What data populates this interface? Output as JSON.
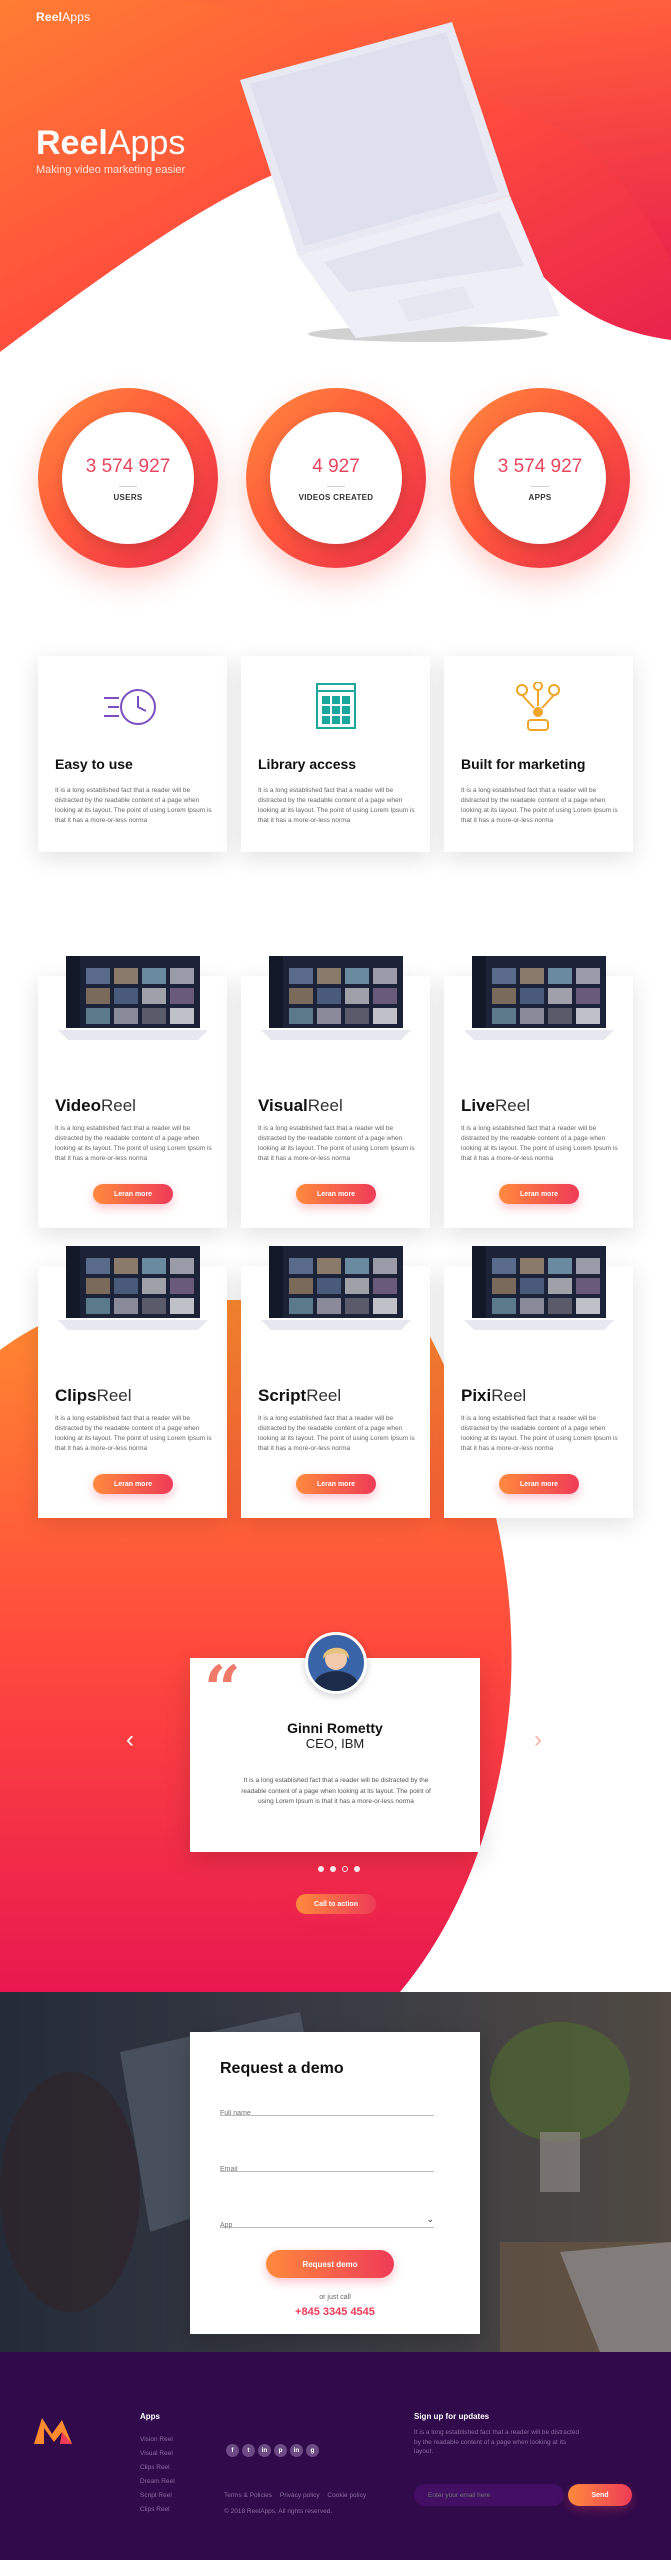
{
  "brand": {
    "bold": "Reel",
    "thin": "Apps"
  },
  "hero": {
    "title_bold": "Reel",
    "title_thin": "Apps",
    "tagline": "Making video marketing easier"
  },
  "stats": [
    {
      "value": "3 574 927",
      "label": "USERS"
    },
    {
      "value": "4 927",
      "label": "VIDEOS CREATED"
    },
    {
      "value": "3 574 927",
      "label": "APPS"
    }
  ],
  "features": [
    {
      "title": "Easy to use",
      "icon": "clock-speed-icon",
      "text": "It is a long established fact that a reader will be distracted by the readable content of a page when looking at its layout. The point of using Lorem Ipsum is that it has a more-or-less norma"
    },
    {
      "title": "Library access",
      "icon": "grid-library-icon",
      "text": "It is a long established fact that a reader will be distracted by the readable content of a page when looking at its layout. The point of using Lorem Ipsum is that it has a more-or-less norma"
    },
    {
      "title": "Built for marketing",
      "icon": "network-person-icon",
      "text": "It is a long established fact that a reader will be distracted by the readable content of a page when looking at its layout. The point of using Lorem Ipsum is that it has a more-or-less norma"
    }
  ],
  "products": [
    {
      "bold": "Video",
      "thin": "Reel",
      "text": "It is a long established fact that a reader will be distracted by the readable content of a page when looking at its layout. The point of using Lorem Ipsum is that it has a more-or-less norma",
      "button": "Leran more"
    },
    {
      "bold": "Visual",
      "thin": "Reel",
      "text": "It is a long established fact that a reader will be distracted by the readable content of a page when looking at its layout. The point of using Lorem Ipsum is that it has a more-or-less norma",
      "button": "Leran more"
    },
    {
      "bold": "Live",
      "thin": "Reel",
      "text": "It is a long established fact that a reader will be distracted by the readable content of a page when looking at its layout. The point of using Lorem Ipsum is that it has a more-or-less norma",
      "button": "Leran more"
    },
    {
      "bold": "Clips",
      "thin": "Reel",
      "text": "It is a long established fact that a reader will be distracted by the readable content of a page when looking at its layout. The point of using Lorem Ipsum is that it has a more-or-less norma",
      "button": "Leran more"
    },
    {
      "bold": "Script",
      "thin": "Reel",
      "text": "It is a long established fact that a reader will be distracted by the readable content of a page when looking at its layout. The point of using Lorem Ipsum is that it has a more-or-less norma",
      "button": "Leran more"
    },
    {
      "bold": "Pixi",
      "thin": "Reel",
      "text": "It is a long established fact that a reader will be distracted by the readable content of a page when looking at its layout. The point of using Lorem Ipsum is that it has a more-or-less norma",
      "button": "Leran more"
    }
  ],
  "testimonial": {
    "name": "Ginni Rometty",
    "role": "CEO, IBM",
    "text": "It is a long established fact that a reader will be distracted by the readable content of a page when looking at its layout. The point of using Lorem Ipsum is that it has a more-or-less norma",
    "cta": "Call to action",
    "slides": 4,
    "active_slide": 3
  },
  "demo": {
    "title": "Request a demo",
    "full_name_placeholder": "Full name",
    "email_placeholder": "Email",
    "app_placeholder": "App",
    "button": "Request demo",
    "or_call": "or just call",
    "phone": "+845 3345 4545"
  },
  "footer": {
    "apps_title": "Apps",
    "apps": [
      "Vision Reel",
      "Visual Reel",
      "Clips Reel",
      "Dream Reel",
      "Script Reel",
      "Clips Reel"
    ],
    "socials": [
      "f",
      "t",
      "in",
      "p",
      "in",
      "g"
    ],
    "links": [
      "Terms & Policies",
      "Privacy policy",
      "Cookie policy"
    ],
    "copyright": "© 2018 ReelApps. All rights reserved.",
    "signup_title": "Sign up for updates",
    "signup_text": "It is a long established fact that a reader will be distracted by the readable content of a page when looking at its layout.",
    "email_placeholder": "Enter your email here",
    "send": "Send"
  },
  "colors": {
    "accent_orange": "#ff7a3a",
    "accent_pink": "#ef3b57",
    "footer_bg": "#300a4a"
  }
}
